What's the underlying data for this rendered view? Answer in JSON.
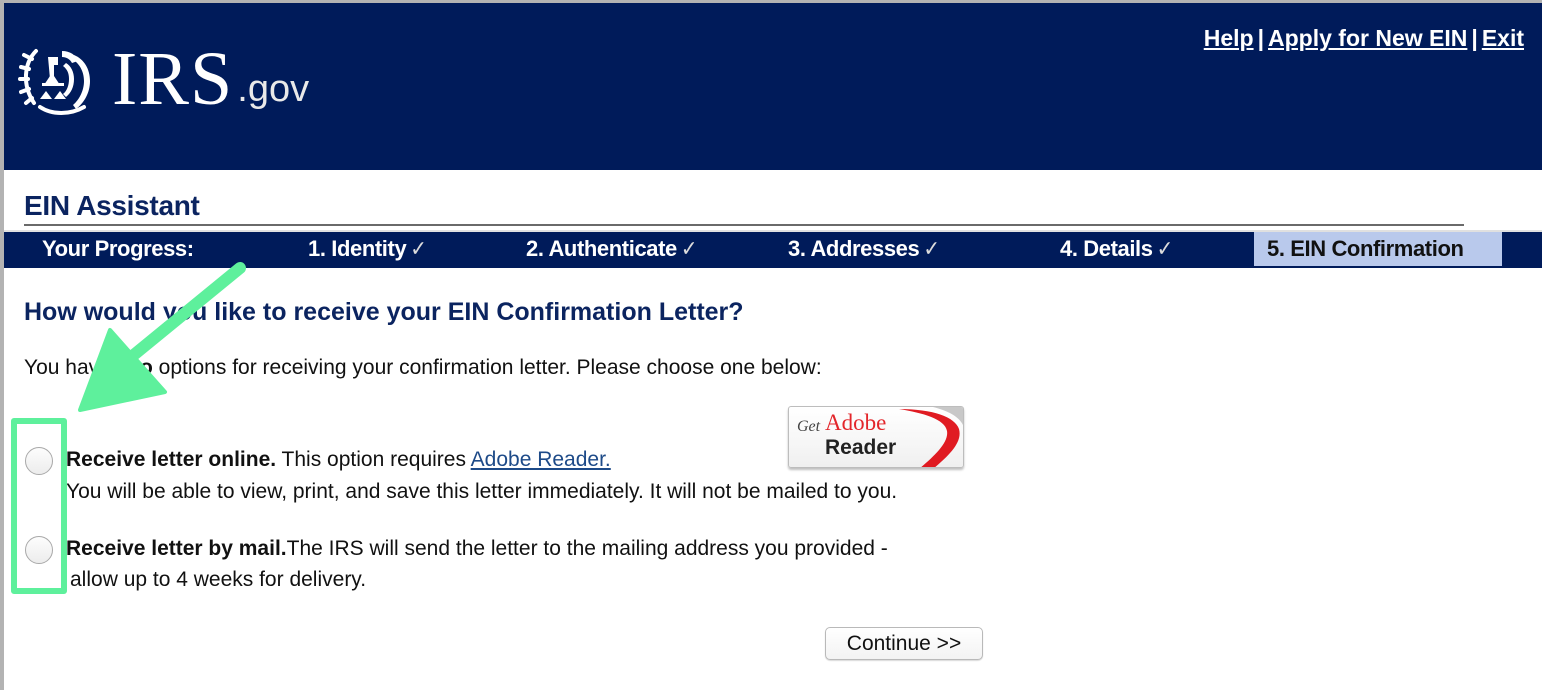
{
  "header": {
    "logo_main": "IRS",
    "logo_suffix": ".gov",
    "links": [
      "Help",
      "Apply for New EIN",
      "Exit"
    ],
    "link_separator": "|",
    "background_color": "#001b5a"
  },
  "assistant": {
    "title": "EIN Assistant"
  },
  "progress": {
    "label": "Your Progress:",
    "steps": [
      {
        "label": "1. Identity",
        "completed": true
      },
      {
        "label": "2. Authenticate",
        "completed": true
      },
      {
        "label": "3. Addresses",
        "completed": true
      },
      {
        "label": "4. Details",
        "completed": true
      },
      {
        "label": "5. EIN Confirmation",
        "completed": false,
        "active": true
      }
    ],
    "check_glyph": "✓",
    "active_color": "#b9c9ec"
  },
  "main": {
    "question": "How would you like to receive your EIN Confirmation Letter?",
    "intro_prefix": "You have ",
    "intro_bold": "two",
    "intro_suffix": " options for receiving your confirmation letter. Please choose one below:",
    "options": [
      {
        "bold": "Receive letter online.",
        "text": " This option requires ",
        "link": "Adobe Reader.",
        "line2": " You will be able to view, print, and save this letter immediately. It will not be mailed to you.",
        "selected": false
      },
      {
        "bold": "Receive letter by mail.",
        "text": "The IRS will send the letter to the mailing address you provided -",
        "line2": "allow up to 4 weeks for delivery.",
        "selected": false
      }
    ],
    "adobe_badge": {
      "get": "Get",
      "brand": "Adobe",
      "product": "Reader"
    },
    "continue_label": "Continue >>"
  },
  "annotation": {
    "color": "#5ef09c"
  }
}
